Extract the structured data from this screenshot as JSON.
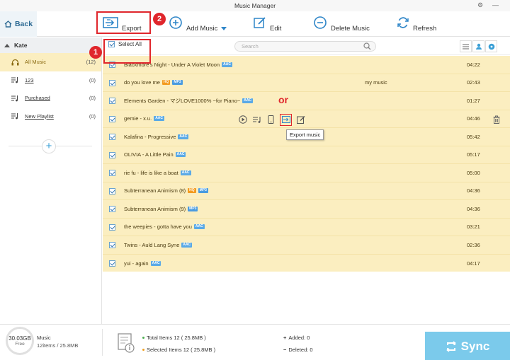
{
  "window": {
    "title": "Music Manager",
    "settings_glyph": "⚙",
    "minimize_glyph": "—"
  },
  "toolbar": {
    "back_label": "Back",
    "export_label": "Export",
    "add_music_label": "Add Music",
    "edit_label": "Edit",
    "delete_label": "Delete Music",
    "refresh_label": "Refresh"
  },
  "annotations": {
    "badge_1": "1",
    "badge_2": "2",
    "or_label": "or",
    "accent_color": "#e0262c"
  },
  "sidebar": {
    "device_name": "Kate",
    "items": [
      {
        "label": "All Music",
        "count": "(12)"
      },
      {
        "label": "123",
        "count": "(0)"
      },
      {
        "label": "Purchased",
        "count": "(0)"
      },
      {
        "label": "New Playlist",
        "count": "(0)"
      }
    ],
    "add_playlist_glyph": "+"
  },
  "subheader": {
    "select_all_label": "Select All",
    "search_placeholder": "Search"
  },
  "songs": [
    {
      "title": "Blackmore's Night - Under A Violet Moon",
      "tags": [
        "AAC"
      ],
      "album": "",
      "duration": "04:22"
    },
    {
      "title": "do you love me",
      "tags": [
        "HQ",
        "MP3"
      ],
      "album": "my music",
      "duration": "02:43"
    },
    {
      "title": "Elements Garden - マジLOVE1000% ~for Piano~",
      "tags": [
        "AAC"
      ],
      "album": "",
      "duration": "01:27"
    },
    {
      "title": "gemie - x.u.",
      "tags": [
        "AAC"
      ],
      "album": "",
      "duration": "04:46"
    },
    {
      "title": "Kalafina - Progressive",
      "tags": [
        "AAC"
      ],
      "album": "",
      "duration": "05:42"
    },
    {
      "title": "OLIVIA - A Little Pain",
      "tags": [
        "AAC"
      ],
      "album": "",
      "duration": "05:17"
    },
    {
      "title": "rie fu - life is like a boat",
      "tags": [
        "AAC"
      ],
      "album": "",
      "duration": "05:00"
    },
    {
      "title": "Subterranean Animism (8)",
      "tags": [
        "HQ",
        "MP3"
      ],
      "album": "",
      "duration": "04:36"
    },
    {
      "title": "Subterranean Animism (9)",
      "tags": [
        "MP3"
      ],
      "album": "",
      "duration": "04:36"
    },
    {
      "title": "the weepies - gotta have you",
      "tags": [
        "AAC"
      ],
      "album": "",
      "duration": "03:21"
    },
    {
      "title": "Twins - Auld Lang Syne",
      "tags": [
        "AAC"
      ],
      "album": "",
      "duration": "02:36"
    },
    {
      "title": "yui - again",
      "tags": [
        "AAC"
      ],
      "album": "",
      "duration": "04:17"
    }
  ],
  "tooltip": {
    "text": "Export music"
  },
  "bottom": {
    "storage_gb": "30.03GB",
    "storage_free": "Free",
    "music_label": "Music",
    "music_summary": "12items / 25.8MB",
    "total_items": "Total Items 12 ( 25.8MB )",
    "selected_items": "Selected Items 12 ( 25.8MB )",
    "added": "Added: 0",
    "deleted": "Deleted: 0",
    "sync_label": "Sync"
  }
}
